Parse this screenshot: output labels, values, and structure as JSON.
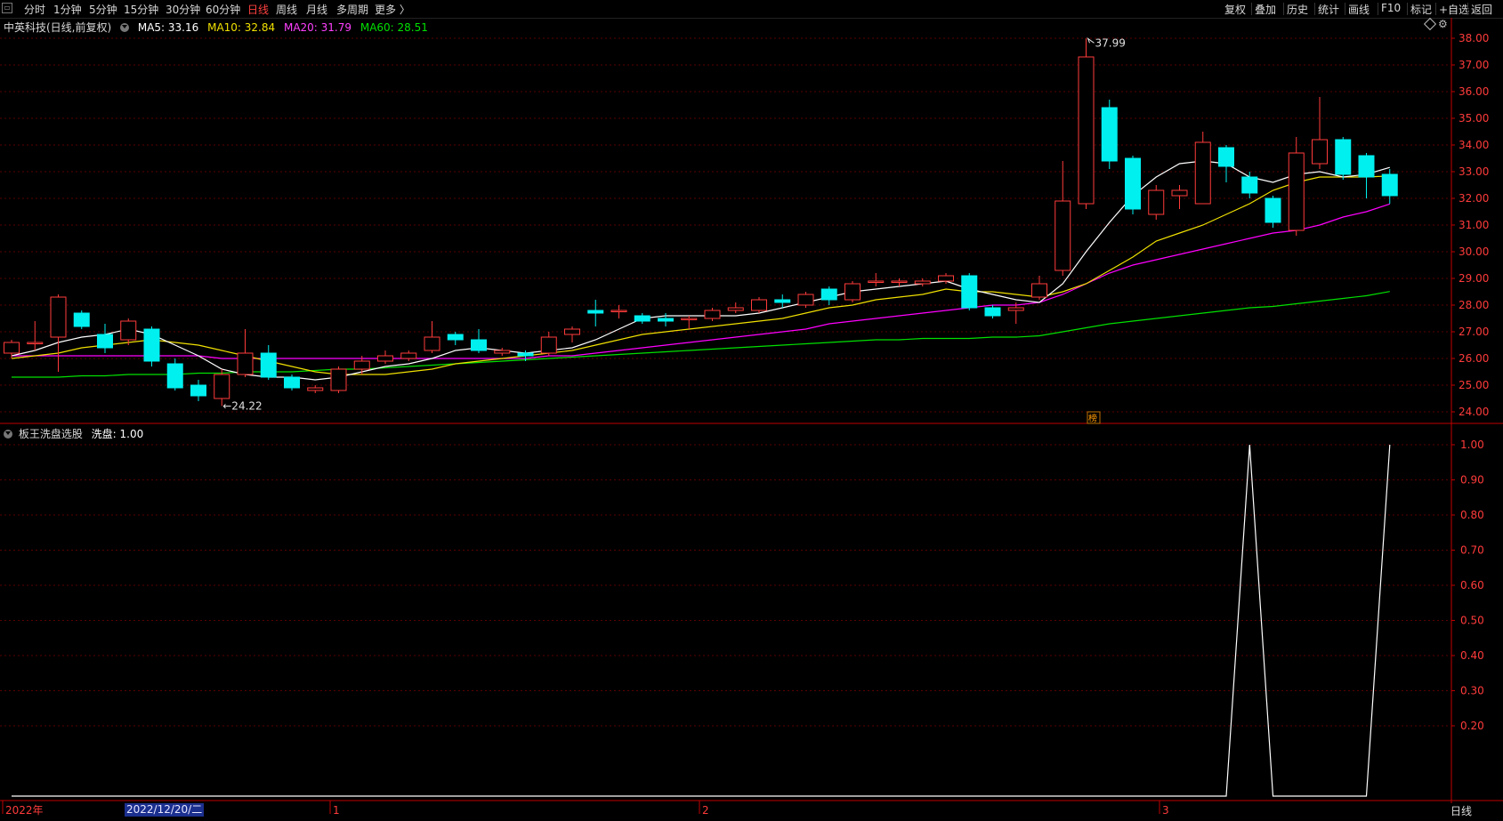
{
  "toolbar": {
    "periods": [
      {
        "label": "分时",
        "active": false
      },
      {
        "label": "1分钟",
        "active": false
      },
      {
        "label": "5分钟",
        "active": false
      },
      {
        "label": "15分钟",
        "active": false
      },
      {
        "label": "30分钟",
        "active": false
      },
      {
        "label": "60分钟",
        "active": false
      },
      {
        "label": "日线",
        "active": true
      },
      {
        "label": "周线",
        "active": false
      },
      {
        "label": "月线",
        "active": false
      },
      {
        "label": "多周期",
        "active": false
      },
      {
        "label": "更多 〉",
        "active": false
      }
    ],
    "right": [
      "复权",
      "叠加",
      "历史",
      "统计",
      "画线",
      "F10",
      "标记",
      "+自选",
      "返回"
    ]
  },
  "main_legend": {
    "title": "中英科技(日线,前复权)",
    "ma5": "MA5: 33.16",
    "ma10": "MA10: 32.84",
    "ma20": "MA20: 31.79",
    "ma60": "MA60: 28.51"
  },
  "sub_legend": {
    "title": "板王洗盘选股",
    "value": "洗盘: 1.00"
  },
  "annotations": {
    "high": "37.99",
    "low": "←24.22",
    "marker": "榜"
  },
  "price_axis": {
    "ticks": [
      "38.00",
      "37.00",
      "36.00",
      "35.00",
      "34.00",
      "33.00",
      "32.00",
      "31.00",
      "30.00",
      "29.00",
      "28.00",
      "27.00",
      "26.00",
      "25.00",
      "24.00"
    ]
  },
  "sub_axis": {
    "ticks": [
      "1.00",
      "0.90",
      "0.80",
      "0.70",
      "0.60",
      "0.50",
      "0.40",
      "0.30",
      "0.20"
    ]
  },
  "time_axis": {
    "labels": [
      "2022年",
      "1",
      "2",
      "3"
    ],
    "selected_date": "2022/12/20/二",
    "period": "日线"
  },
  "colors": {
    "up": "#ff3b3b",
    "down": "#00f0f0",
    "ma5": "#ffffff",
    "ma10": "#f0e000",
    "ma20": "#ff00ff",
    "ma60": "#00e000",
    "axis": "#c00000"
  },
  "chart_data": [
    {
      "type": "candlestick",
      "title": "中英科技(日线,前复权)",
      "ylim": [
        23.7,
        38.4
      ],
      "candles": [
        {
          "o": 26.2,
          "c": 26.6,
          "h": 26.7,
          "l": 26.0
        },
        {
          "o": 26.6,
          "c": 26.6,
          "h": 27.4,
          "l": 26.3
        },
        {
          "o": 26.8,
          "c": 28.3,
          "h": 28.4,
          "l": 25.5
        },
        {
          "o": 27.7,
          "c": 27.2,
          "h": 27.8,
          "l": 27.1
        },
        {
          "o": 26.9,
          "c": 26.4,
          "h": 27.3,
          "l": 26.2
        },
        {
          "o": 26.7,
          "c": 27.4,
          "h": 27.5,
          "l": 26.5
        },
        {
          "o": 27.1,
          "c": 25.9,
          "h": 27.2,
          "l": 25.7
        },
        {
          "o": 25.8,
          "c": 24.9,
          "h": 26.0,
          "l": 24.8
        },
        {
          "o": 25.0,
          "c": 24.6,
          "h": 25.2,
          "l": 24.4
        },
        {
          "o": 24.5,
          "c": 25.4,
          "h": 25.6,
          "l": 24.22
        },
        {
          "o": 25.4,
          "c": 26.2,
          "h": 27.1,
          "l": 25.3
        },
        {
          "o": 26.2,
          "c": 25.3,
          "h": 26.5,
          "l": 25.2
        },
        {
          "o": 25.3,
          "c": 24.9,
          "h": 25.4,
          "l": 24.8
        },
        {
          "o": 24.8,
          "c": 24.9,
          "h": 25.0,
          "l": 24.7
        },
        {
          "o": 24.8,
          "c": 25.6,
          "h": 25.7,
          "l": 24.7
        },
        {
          "o": 25.6,
          "c": 25.9,
          "h": 26.1,
          "l": 25.4
        },
        {
          "o": 25.9,
          "c": 26.1,
          "h": 26.3,
          "l": 25.8
        },
        {
          "o": 26.0,
          "c": 26.2,
          "h": 26.3,
          "l": 25.9
        },
        {
          "o": 26.3,
          "c": 26.8,
          "h": 27.4,
          "l": 26.2
        },
        {
          "o": 26.9,
          "c": 26.7,
          "h": 27.0,
          "l": 26.5
        },
        {
          "o": 26.7,
          "c": 26.3,
          "h": 27.1,
          "l": 26.2
        },
        {
          "o": 26.2,
          "c": 26.3,
          "h": 26.4,
          "l": 26.1
        },
        {
          "o": 26.2,
          "c": 26.1,
          "h": 26.3,
          "l": 25.9
        },
        {
          "o": 26.2,
          "c": 26.8,
          "h": 27.0,
          "l": 26.1
        },
        {
          "o": 26.9,
          "c": 27.1,
          "h": 27.2,
          "l": 26.6
        },
        {
          "o": 27.8,
          "c": 27.7,
          "h": 28.2,
          "l": 27.2
        },
        {
          "o": 27.8,
          "c": 27.8,
          "h": 28.0,
          "l": 27.5
        },
        {
          "o": 27.6,
          "c": 27.4,
          "h": 27.7,
          "l": 27.3
        },
        {
          "o": 27.5,
          "c": 27.4,
          "h": 27.7,
          "l": 27.2
        },
        {
          "o": 27.5,
          "c": 27.5,
          "h": 27.6,
          "l": 27.1
        },
        {
          "o": 27.5,
          "c": 27.8,
          "h": 27.9,
          "l": 27.4
        },
        {
          "o": 27.8,
          "c": 27.9,
          "h": 28.1,
          "l": 27.7
        },
        {
          "o": 27.8,
          "c": 28.2,
          "h": 28.3,
          "l": 27.7
        },
        {
          "o": 28.2,
          "c": 28.1,
          "h": 28.4,
          "l": 27.9
        },
        {
          "o": 28.0,
          "c": 28.4,
          "h": 28.5,
          "l": 27.9
        },
        {
          "o": 28.6,
          "c": 28.2,
          "h": 28.7,
          "l": 28.0
        },
        {
          "o": 28.2,
          "c": 28.8,
          "h": 28.9,
          "l": 28.1
        },
        {
          "o": 28.9,
          "c": 28.9,
          "h": 29.2,
          "l": 28.7
        },
        {
          "o": 28.9,
          "c": 28.9,
          "h": 29.0,
          "l": 28.7
        },
        {
          "o": 28.8,
          "c": 28.9,
          "h": 29.0,
          "l": 28.7
        },
        {
          "o": 28.9,
          "c": 29.1,
          "h": 29.2,
          "l": 28.8
        },
        {
          "o": 29.1,
          "c": 27.9,
          "h": 29.2,
          "l": 27.8
        },
        {
          "o": 27.9,
          "c": 27.6,
          "h": 28.0,
          "l": 27.5
        },
        {
          "o": 27.8,
          "c": 27.9,
          "h": 28.1,
          "l": 27.3
        },
        {
          "o": 28.3,
          "c": 28.8,
          "h": 29.1,
          "l": 28.2
        },
        {
          "o": 29.3,
          "c": 31.9,
          "h": 33.4,
          "l": 29.1
        },
        {
          "o": 31.8,
          "c": 37.3,
          "h": 37.99,
          "l": 31.6
        },
        {
          "o": 35.4,
          "c": 33.4,
          "h": 35.7,
          "l": 33.1
        },
        {
          "o": 33.5,
          "c": 31.6,
          "h": 33.6,
          "l": 31.4
        },
        {
          "o": 31.4,
          "c": 32.3,
          "h": 32.5,
          "l": 31.2
        },
        {
          "o": 32.1,
          "c": 32.3,
          "h": 32.5,
          "l": 31.6
        },
        {
          "o": 31.8,
          "c": 34.1,
          "h": 34.5,
          "l": 31.8
        },
        {
          "o": 33.9,
          "c": 33.2,
          "h": 34.0,
          "l": 32.6
        },
        {
          "o": 32.8,
          "c": 32.2,
          "h": 33.0,
          "l": 32.0
        },
        {
          "o": 32.0,
          "c": 31.1,
          "h": 32.1,
          "l": 30.9
        },
        {
          "o": 30.8,
          "c": 33.7,
          "h": 34.3,
          "l": 30.6
        },
        {
          "o": 33.3,
          "c": 34.2,
          "h": 35.8,
          "l": 33.1
        },
        {
          "o": 34.2,
          "c": 32.9,
          "h": 34.3,
          "l": 32.7
        },
        {
          "o": 33.6,
          "c": 32.8,
          "h": 33.7,
          "l": 32.0
        },
        {
          "o": 32.9,
          "c": 32.1,
          "h": 33.1,
          "l": 31.8
        }
      ],
      "ma5": [
        26.1,
        26.3,
        26.6,
        26.8,
        26.9,
        27.1,
        26.9,
        26.5,
        26.1,
        25.6,
        25.4,
        25.3,
        25.3,
        25.2,
        25.3,
        25.5,
        25.7,
        25.8,
        26.0,
        26.3,
        26.4,
        26.3,
        26.2,
        26.3,
        26.4,
        26.7,
        27.1,
        27.5,
        27.6,
        27.6,
        27.6,
        27.6,
        27.7,
        27.9,
        28.1,
        28.3,
        28.5,
        28.6,
        28.7,
        28.8,
        28.9,
        28.6,
        28.4,
        28.2,
        28.1,
        28.8,
        30.0,
        31.1,
        32.1,
        32.8,
        33.3,
        33.4,
        33.3,
        32.8,
        32.6,
        32.9,
        33.0,
        32.8,
        32.9,
        33.16
      ],
      "ma10": [
        26.0,
        26.1,
        26.2,
        26.4,
        26.5,
        26.6,
        26.7,
        26.6,
        26.5,
        26.3,
        26.1,
        25.9,
        25.7,
        25.5,
        25.4,
        25.4,
        25.4,
        25.5,
        25.6,
        25.8,
        25.9,
        26.0,
        26.1,
        26.2,
        26.3,
        26.5,
        26.7,
        26.9,
        27.0,
        27.1,
        27.2,
        27.3,
        27.4,
        27.5,
        27.7,
        27.9,
        28.0,
        28.2,
        28.3,
        28.4,
        28.6,
        28.5,
        28.5,
        28.4,
        28.3,
        28.5,
        28.8,
        29.3,
        29.8,
        30.4,
        30.7,
        31.0,
        31.4,
        31.8,
        32.3,
        32.6,
        32.8,
        32.8,
        32.8,
        32.84
      ],
      "ma20": [
        26.1,
        26.1,
        26.1,
        26.1,
        26.1,
        26.1,
        26.1,
        26.1,
        26.1,
        26.0,
        26.0,
        26.0,
        26.0,
        26.0,
        26.0,
        26.0,
        26.0,
        26.0,
        26.0,
        26.0,
        26.0,
        26.0,
        26.0,
        26.1,
        26.1,
        26.2,
        26.3,
        26.4,
        26.5,
        26.6,
        26.7,
        26.8,
        26.9,
        27.0,
        27.1,
        27.3,
        27.4,
        27.5,
        27.6,
        27.7,
        27.8,
        27.9,
        28.0,
        28.0,
        28.1,
        28.4,
        28.8,
        29.2,
        29.5,
        29.7,
        29.9,
        30.1,
        30.3,
        30.5,
        30.7,
        30.8,
        31.0,
        31.3,
        31.5,
        31.79
      ],
      "ma60": [
        25.3,
        25.3,
        25.3,
        25.35,
        25.35,
        25.4,
        25.4,
        25.4,
        25.45,
        25.45,
        25.5,
        25.5,
        25.5,
        25.55,
        25.6,
        25.6,
        25.65,
        25.7,
        25.75,
        25.8,
        25.85,
        25.9,
        25.95,
        26.0,
        26.05,
        26.1,
        26.15,
        26.2,
        26.25,
        26.3,
        26.35,
        26.4,
        26.45,
        26.5,
        26.55,
        26.6,
        26.65,
        26.7,
        26.7,
        26.75,
        26.75,
        26.75,
        26.8,
        26.8,
        26.85,
        27.0,
        27.15,
        27.3,
        27.4,
        27.5,
        27.6,
        27.7,
        27.8,
        27.9,
        27.95,
        28.05,
        28.15,
        28.25,
        28.35,
        28.51
      ]
    },
    {
      "type": "line",
      "title": "板王洗盘选股",
      "series": [
        {
          "name": "洗盘",
          "values": [
            0,
            0,
            0,
            0,
            0,
            0,
            0,
            0,
            0,
            0,
            0,
            0,
            0,
            0,
            0,
            0,
            0,
            0,
            0,
            0,
            0,
            0,
            0,
            0,
            0,
            0,
            0,
            0,
            0,
            0,
            0,
            0,
            0,
            0,
            0,
            0,
            0,
            0,
            0,
            0,
            0,
            0,
            0,
            0,
            0,
            0,
            0,
            0,
            0,
            0,
            0,
            0,
            0,
            1,
            0,
            0,
            0,
            0,
            0,
            1
          ]
        }
      ],
      "ylim": [
        0,
        1.0
      ]
    }
  ]
}
